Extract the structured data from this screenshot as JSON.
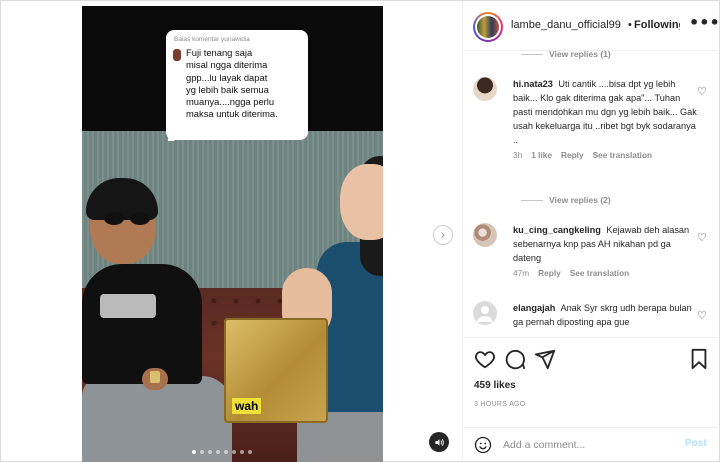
{
  "post": {
    "reply_bubble": {
      "header": "Balas komentar yunawidia",
      "text": "Fuji tenang saja\nmisal ngga diterima\ngpp...lu layak dapat\nyg lebih baik semua\nmuanya....ngga perlu\nmaksa untuk diterima."
    },
    "video_caption": "wah",
    "carousel": {
      "count": 8,
      "active_index": 0
    }
  },
  "header": {
    "username": "lambe_danu_official99",
    "separator": "•",
    "follow_label": "Following",
    "more_icon": "more-horizontal-icon"
  },
  "comments": {
    "view_replies_top": "View replies (1)",
    "items": [
      {
        "username": "hi.nata23",
        "text": "Uti cantik ....bisa dpt yg lebih baik... Klo gak diterima gak apa\"... Tuhan pasti mendohkan mu dgn yg lebih baik... Gak usah kekeluarga itu ..ribet bgt byk sodaranya ..",
        "time": "3h",
        "likes": "1 like",
        "reply": "Reply",
        "translate": "See translation",
        "avatar_color": "#d9c6b8"
      },
      {
        "username": "ku_cing_cangkeling",
        "text": "Kejawab deh alasan sebenarnya knp pas AH nikahan pd ga dateng",
        "time": "47m",
        "reply": "Reply",
        "translate": "See translation",
        "avatar_color": "#b8a090"
      },
      {
        "username": "elangajah",
        "text": "Anak Syr skrg udh berapa bulan ga pernah diposting apa gue",
        "avatar_color": "#dbdbdb"
      }
    ],
    "view_replies_mid": "View replies (2)"
  },
  "actions": {
    "likes": "459 likes",
    "time": "3 HOURS AGO"
  },
  "add_comment": {
    "placeholder": "Add a comment...",
    "post_label": "Post"
  }
}
